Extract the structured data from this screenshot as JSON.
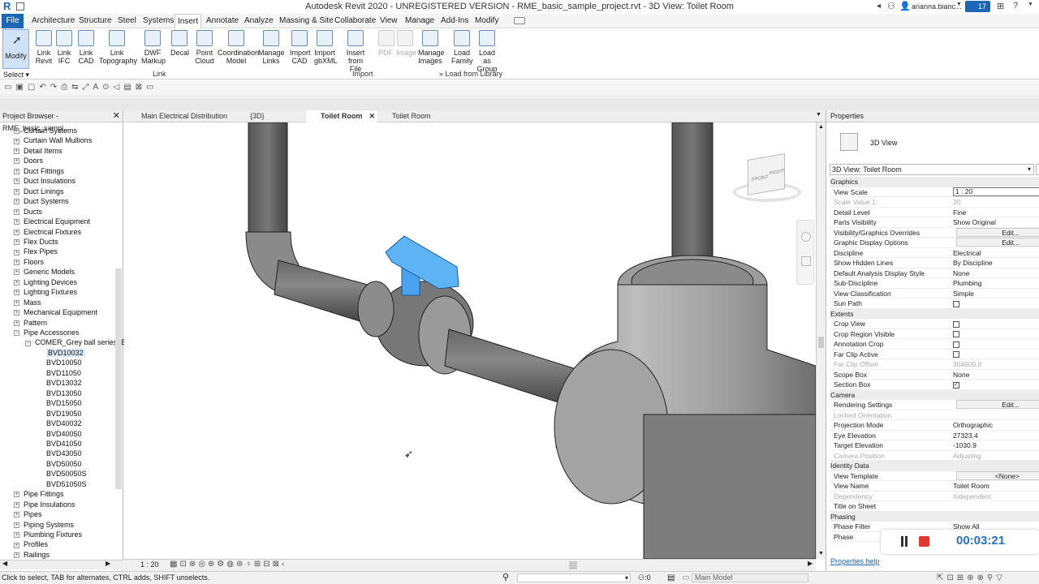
{
  "window": {
    "title": "Autodesk Revit 2020 - UNREGISTERED VERSION - RME_basic_sample_project.rvt - 3D View: Toilet Room",
    "user": "arianna.bianc...",
    "notif_count": "17"
  },
  "ribbon_tabs": [
    "File",
    "Architecture",
    "Structure",
    "Steel",
    "Systems",
    "Insert",
    "Annotate",
    "Analyze",
    "Massing & Site",
    "Collaborate",
    "View",
    "Manage",
    "Add-Ins",
    "Modify"
  ],
  "ribbon": {
    "modify": "Modify",
    "select": "Select",
    "buttons": [
      {
        "l1": "Link",
        "l2": "Revit",
        "icon": "link-revit-icon"
      },
      {
        "l1": "Link",
        "l2": "IFC",
        "icon": "link-ifc-icon"
      },
      {
        "l1": "Link",
        "l2": "CAD",
        "icon": "link-cad-icon"
      },
      {
        "l1": "Link",
        "l2": "Topography",
        "icon": "link-topography-icon"
      },
      {
        "l1": "DWF",
        "l2": "Markup",
        "icon": "dwf-markup-icon"
      },
      {
        "l1": "Decal",
        "l2": "",
        "icon": "decal-icon"
      },
      {
        "l1": "Point",
        "l2": "Cloud",
        "icon": "point-cloud-icon"
      },
      {
        "l1": "Coordination",
        "l2": "Model",
        "icon": "coordination-model-icon"
      },
      {
        "l1": "Manage",
        "l2": "Links",
        "icon": "manage-links-icon"
      },
      {
        "l1": "Import",
        "l2": "CAD",
        "icon": "import-cad-icon"
      },
      {
        "l1": "Import",
        "l2": "gbXML",
        "icon": "import-gbxml-icon"
      },
      {
        "l1": "Insert",
        "l2": "from File",
        "icon": "insert-from-file-icon"
      },
      {
        "l1": "PDF",
        "l2": "",
        "icon": "pdf-icon"
      },
      {
        "l1": "Image",
        "l2": "",
        "icon": "image-icon"
      },
      {
        "l1": "Manage",
        "l2": "Images",
        "icon": "manage-images-icon"
      },
      {
        "l1": "Load",
        "l2": "Family",
        "icon": "load-family-icon"
      },
      {
        "l1": "Load as",
        "l2": "Group",
        "icon": "load-as-group-icon"
      }
    ],
    "groups": {
      "link": "Link",
      "import": "Import",
      "library": "Load from Library"
    }
  },
  "project_browser": {
    "title": "Project Browser - RME_basic_sampl...",
    "items": [
      "Curtain Systems",
      "Curtain Wall Mullions",
      "Detail Items",
      "Doors",
      "Duct Fittings",
      "Duct Insulations",
      "Duct Linings",
      "Duct Systems",
      "Ducts",
      "Electrical Equipment",
      "Electrical Fixtures",
      "Flex Ducts",
      "Flex Pipes",
      "Floors",
      "Generic Models",
      "Lighting Devices",
      "Lighting Fixtures",
      "Mass",
      "Mechanical Equipment",
      "Pattern",
      "Pipe Accessories"
    ],
    "family": "COMER_Grey ball series_B",
    "types": [
      "BVD10032",
      "BVD10050",
      "BVD11050",
      "BVD13032",
      "BVD13050",
      "BVD15050",
      "BVD19050",
      "BVD40032",
      "BVD40050",
      "BVD41050",
      "BVD43050",
      "BVD50050",
      "BVD50050S",
      "BVD51050S"
    ],
    "items_after": [
      "Pipe Fittings",
      "Pipe Insulations",
      "Pipes",
      "Piping Systems",
      "Plumbing Fixtures",
      "Profiles",
      "Railings"
    ]
  },
  "view_tabs": [
    {
      "label": "Main Electrical Distribution",
      "active": false
    },
    {
      "label": "{3D}",
      "active": false
    },
    {
      "label": "Toilet Room",
      "active": true
    },
    {
      "label": "Toilet Room",
      "active": false
    }
  ],
  "view_bar": {
    "scale": "1 : 20"
  },
  "viewcube": {
    "front": "FRONT",
    "right": "RIGHT"
  },
  "properties": {
    "title": "Properties",
    "type": "3D View",
    "selector": "3D View: Toilet Room",
    "sections": [
      {
        "name": "Graphics",
        "rows": [
          {
            "k": "View Scale",
            "v": "1 : 20",
            "kind": "input"
          },
          {
            "k": "Scale Value    1:",
            "v": "20",
            "kind": "dim"
          },
          {
            "k": "Detail Level",
            "v": "Fine"
          },
          {
            "k": "Parts Visibility",
            "v": "Show Original"
          },
          {
            "k": "Visibility/Graphics Overrides",
            "v": "Edit...",
            "kind": "button"
          },
          {
            "k": "Graphic Display Options",
            "v": "Edit...",
            "kind": "button"
          },
          {
            "k": "Discipline",
            "v": "Electrical"
          },
          {
            "k": "Show Hidden Lines",
            "v": "By Discipline"
          },
          {
            "k": "Default Analysis Display Style",
            "v": "None"
          },
          {
            "k": "Sub-Discipline",
            "v": "Plumbing"
          },
          {
            "k": "View Classification",
            "v": "Simple"
          },
          {
            "k": "Sun Path",
            "v": "",
            "kind": "check",
            "checked": false
          }
        ]
      },
      {
        "name": "Extents",
        "rows": [
          {
            "k": "Crop View",
            "v": "",
            "kind": "check",
            "checked": false
          },
          {
            "k": "Crop Region Visible",
            "v": "",
            "kind": "check",
            "checked": false
          },
          {
            "k": "Annotation Crop",
            "v": "",
            "kind": "check",
            "checked": false
          },
          {
            "k": "Far Clip Active",
            "v": "",
            "kind": "check",
            "checked": false
          },
          {
            "k": "Far Clip Offset",
            "v": "304800.0",
            "kind": "dim"
          },
          {
            "k": "Scope Box",
            "v": "None"
          },
          {
            "k": "Section Box",
            "v": "",
            "kind": "check",
            "checked": true
          }
        ]
      },
      {
        "name": "Camera",
        "rows": [
          {
            "k": "Rendering Settings",
            "v": "Edit...",
            "kind": "button"
          },
          {
            "k": "Locked Orientation",
            "v": "",
            "kind": "dim"
          },
          {
            "k": "Projection Mode",
            "v": "Orthographic"
          },
          {
            "k": "Eye Elevation",
            "v": "27323.4"
          },
          {
            "k": "Target Elevation",
            "v": "-1030.9"
          },
          {
            "k": "Camera Position",
            "v": "Adjusting",
            "kind": "dim"
          }
        ]
      },
      {
        "name": "Identity Data",
        "rows": [
          {
            "k": "View Template",
            "v": "<None>",
            "kind": "button"
          },
          {
            "k": "View Name",
            "v": "Toilet Room"
          },
          {
            "k": "Dependency",
            "v": "Independent",
            "kind": "dim"
          },
          {
            "k": "Title on Sheet",
            "v": ""
          }
        ]
      },
      {
        "name": "Phasing",
        "rows": [
          {
            "k": "Phase Filter",
            "v": "Show All"
          },
          {
            "k": "Phase",
            "v": ""
          }
        ]
      }
    ],
    "help": "Properties help"
  },
  "status": {
    "text": "Click to select, TAB for alternates, CTRL adds, SHIFT unselects.",
    "model": "Main Model",
    "zero": ":0"
  },
  "recorder": {
    "time": "00:03:21"
  }
}
